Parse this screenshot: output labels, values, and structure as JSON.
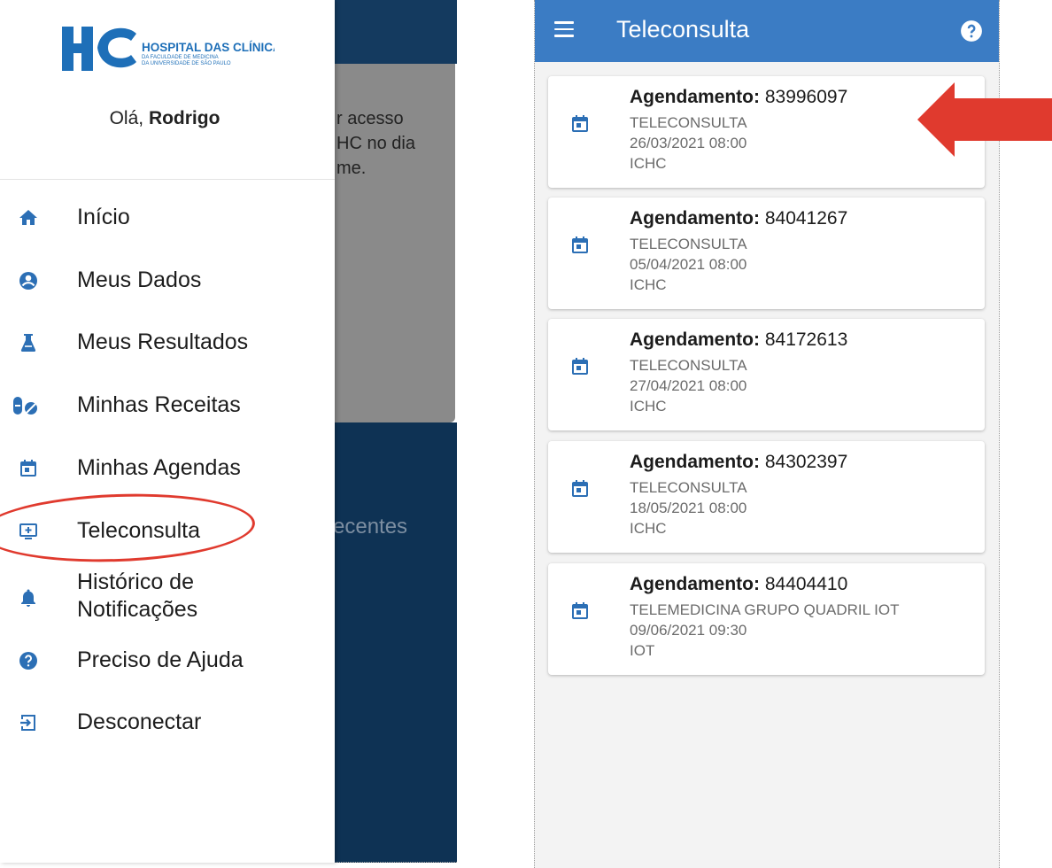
{
  "left": {
    "background_text": "r acesso\nHC no dia\nme.",
    "background_section_label": "ecentes",
    "logo": {
      "mark": "HC",
      "title": "HOSPITAL DAS CLÍNICAS",
      "line2": "DA FACULDADE DE MEDICINA",
      "line3": "DA UNIVERSIDADE DE SÃO PAULO"
    },
    "greeting": {
      "prefix": "Olá, ",
      "name": "Rodrigo"
    },
    "nav": [
      {
        "label": "Início",
        "icon": "home-icon"
      },
      {
        "label": "Meus Dados",
        "icon": "account-circle-icon"
      },
      {
        "label": "Meus Resultados",
        "icon": "flask-icon"
      },
      {
        "label": "Minhas Receitas",
        "icon": "pills-icon"
      },
      {
        "label": "Minhas Agendas",
        "icon": "calendar-icon"
      },
      {
        "label": "Teleconsulta",
        "icon": "monitor-plus-icon"
      },
      {
        "label": "Histórico de\nNotificações",
        "icon": "bell-icon"
      },
      {
        "label": "Preciso de Ajuda",
        "icon": "help-circle-icon"
      },
      {
        "label": "Desconectar",
        "icon": "logout-icon"
      }
    ],
    "highlighted_item": "Teleconsulta"
  },
  "right": {
    "title": "Teleconsulta",
    "appbar_color": "#3b7cc4",
    "icon_color": "#2c6fb5",
    "appointments": [
      {
        "label": "Agendamento:",
        "number": "83996097",
        "type": "TELECONSULTA",
        "datetime": "26/03/2021 08:00",
        "place": "ICHC"
      },
      {
        "label": "Agendamento:",
        "number": "84041267",
        "type": "TELECONSULTA",
        "datetime": "05/04/2021 08:00",
        "place": "ICHC"
      },
      {
        "label": "Agendamento:",
        "number": "84172613",
        "type": "TELECONSULTA",
        "datetime": "27/04/2021 08:00",
        "place": "ICHC"
      },
      {
        "label": "Agendamento:",
        "number": "84302397",
        "type": "TELECONSULTA",
        "datetime": "18/05/2021 08:00",
        "place": "ICHC"
      },
      {
        "label": "Agendamento:",
        "number": "84404410",
        "type": "TELEMEDICINA GRUPO QUADRIL IOT",
        "datetime": "09/06/2021 09:30",
        "place": "IOT"
      }
    ]
  },
  "annotation_color": "#e03a2e"
}
